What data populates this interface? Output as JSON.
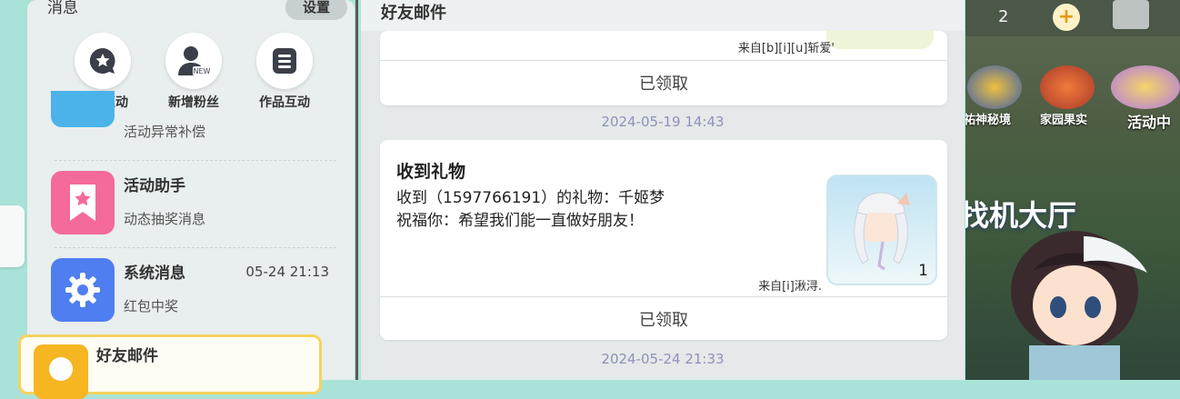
{
  "messages_panel": {
    "title": "消息",
    "settings_label": "设置",
    "shortcuts": [
      {
        "label": "动态互动",
        "icon": "chat-star-icon"
      },
      {
        "label": "新增粉丝",
        "icon": "new-follower-icon"
      },
      {
        "label": "作品互动",
        "icon": "list-icon"
      }
    ],
    "conversations": [
      {
        "name": "",
        "preview": "活动异常补偿",
        "time": "",
        "icon": "mail-icon",
        "color": "#4cb3ea"
      },
      {
        "name": "活动助手",
        "preview": "动态抽奖消息",
        "time": "",
        "icon": "bookmark-star-icon",
        "color": "#f46a9a"
      },
      {
        "name": "系统消息",
        "preview": "红包中奖",
        "time": "05-24 21:13",
        "icon": "gear-icon",
        "color": "#4f7ef0"
      },
      {
        "name": "好友邮件",
        "preview": "",
        "time": "",
        "icon": "friend-icon",
        "color": "#f5b621"
      }
    ]
  },
  "mail_panel": {
    "title": "好友邮件",
    "mails": [
      {
        "from": "来自[b][i][u]斩爱'",
        "status": "已领取"
      },
      {
        "timestamp": "2024-05-19 14:43",
        "title": "收到礼物",
        "body_line1": "收到（1597766191）的礼物：千姬梦",
        "body_line2": "祝福你：希望我们能一直做好朋友！",
        "gift_quantity": "1",
        "from": "来自[i]湫浔.",
        "status": "已领取"
      }
    ],
    "next_timestamp": "2024-05-24 21:33"
  },
  "game_background": {
    "coin_count": "2",
    "plus_label": "+",
    "icons": [
      {
        "label": "祐神秘境"
      },
      {
        "label": "家园果实"
      },
      {
        "label": "活动中"
      }
    ],
    "hall_text": "找机大厅"
  }
}
